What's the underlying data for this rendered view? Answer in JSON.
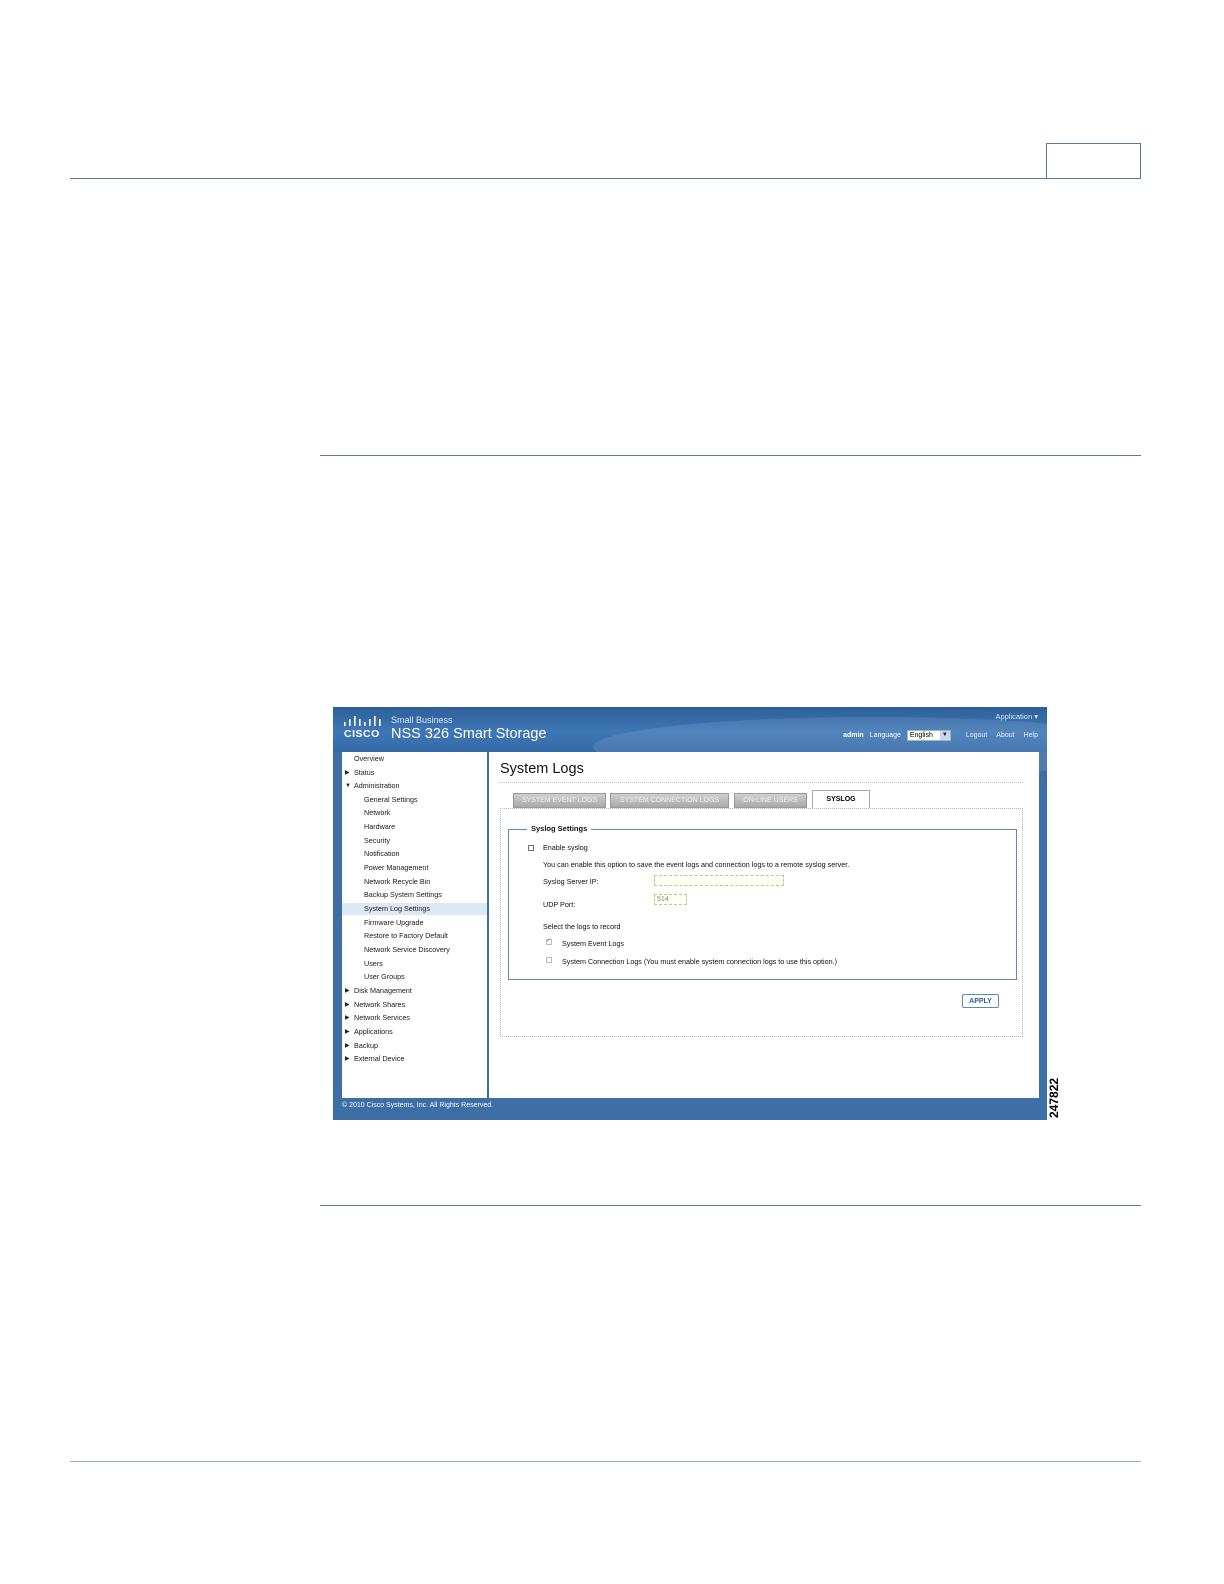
{
  "screenshot": {
    "header": {
      "logo_text": "CISCO",
      "brand_small": "Small Business",
      "product_title": "NSS 326 Smart Storage",
      "application_menu": "Application ▾",
      "user": "admin",
      "language_label": "Language",
      "language_value": "English",
      "links": [
        "Logout",
        "About",
        "Help"
      ]
    },
    "sidebar": {
      "items": [
        {
          "label": "Overview",
          "level": 0,
          "expander": ""
        },
        {
          "label": "Status",
          "level": 0,
          "expander": "▶"
        },
        {
          "label": "Administration",
          "level": 0,
          "expander": "▼"
        },
        {
          "label": "General Settings",
          "level": 1,
          "expander": ""
        },
        {
          "label": "Network",
          "level": 1,
          "expander": ""
        },
        {
          "label": "Hardware",
          "level": 1,
          "expander": ""
        },
        {
          "label": "Security",
          "level": 1,
          "expander": ""
        },
        {
          "label": "Notification",
          "level": 1,
          "expander": ""
        },
        {
          "label": "Power Management",
          "level": 1,
          "expander": ""
        },
        {
          "label": "Network Recycle Bin",
          "level": 1,
          "expander": ""
        },
        {
          "label": "Backup System Settings",
          "level": 1,
          "expander": ""
        },
        {
          "label": "System Log Settings",
          "level": 1,
          "expander": "",
          "active": true
        },
        {
          "label": "Firmware Upgrade",
          "level": 1,
          "expander": ""
        },
        {
          "label": "Restore to Factory Default",
          "level": 1,
          "expander": ""
        },
        {
          "label": "Network Service Discovery",
          "level": 1,
          "expander": ""
        },
        {
          "label": "Users",
          "level": 1,
          "expander": ""
        },
        {
          "label": "User Groups",
          "level": 1,
          "expander": ""
        },
        {
          "label": "Disk Management",
          "level": 0,
          "expander": "▶"
        },
        {
          "label": "Network Shares",
          "level": 0,
          "expander": "▶"
        },
        {
          "label": "Network Services",
          "level": 0,
          "expander": "▶"
        },
        {
          "label": "Applications",
          "level": 0,
          "expander": "▶"
        },
        {
          "label": "Backup",
          "level": 0,
          "expander": "▶"
        },
        {
          "label": "External Device",
          "level": 0,
          "expander": "▶"
        }
      ]
    },
    "main": {
      "page_title": "System Logs",
      "tabs": [
        {
          "label": "SYSTEM EVENT LOGS",
          "active": false
        },
        {
          "label": "SYSTEM CONNECTION LOGS",
          "active": false
        },
        {
          "label": "ON-LINE USERS",
          "active": false
        },
        {
          "label": "SYSLOG",
          "active": true
        }
      ],
      "syslog": {
        "legend": "Syslog Settings",
        "enable_label": "Enable syslog",
        "enable_checked": false,
        "description": "You can enable this option to save the event logs and connection logs to a remote syslog server.",
        "server_ip_label": "Syslog Server IP:",
        "server_ip_value": "",
        "udp_port_label": "UDP Port:",
        "udp_port_value": "514",
        "select_logs_label": "Select the logs to record",
        "log_options": [
          {
            "label": "System Event Logs",
            "checked": true
          },
          {
            "label": "System Connection Logs (You must enable system connection logs to use this option.)",
            "checked": false
          }
        ],
        "apply_label": "APPLY"
      }
    },
    "footer": {
      "copyright": "© 2010 Cisco Systems, Inc. All Rights Reserved."
    }
  },
  "figure_id": "247822",
  "colors": {
    "header_blue": "#3d6ea5",
    "rule": "#5a7a94",
    "active_nav": "#dde8f5"
  }
}
